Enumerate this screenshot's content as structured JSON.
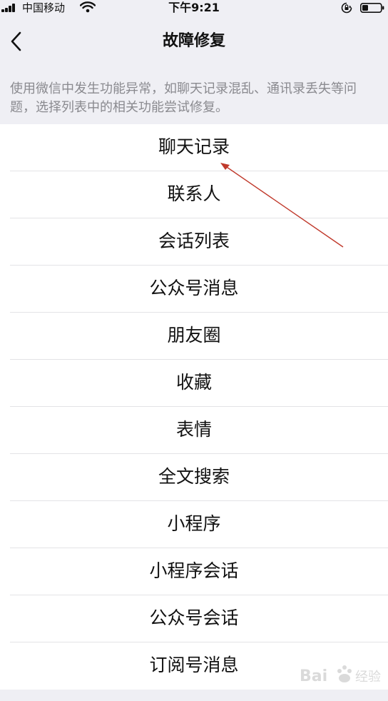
{
  "status_bar": {
    "carrier": "中国移动",
    "time": "下午9:21"
  },
  "nav": {
    "title": "故障修复"
  },
  "description": "使用微信中发生功能异常，如聊天记录混乱、通讯录丢失等问题，选择列表中的相关功能尝试修复。",
  "items": [
    {
      "label": "聊天记录"
    },
    {
      "label": "联系人"
    },
    {
      "label": "会话列表"
    },
    {
      "label": "公众号消息"
    },
    {
      "label": "朋友圈"
    },
    {
      "label": "收藏"
    },
    {
      "label": "表情"
    },
    {
      "label": "全文搜索"
    },
    {
      "label": "小程序"
    },
    {
      "label": "小程序会话"
    },
    {
      "label": "公众号会话"
    },
    {
      "label": "订阅号消息"
    }
  ],
  "icons": {
    "signal": "signal-icon",
    "wifi": "wifi-icon",
    "rotation_lock": "rotation-lock-icon",
    "battery": "battery-icon",
    "back": "chevron-left-icon"
  },
  "annotation_color": "#c0392b"
}
